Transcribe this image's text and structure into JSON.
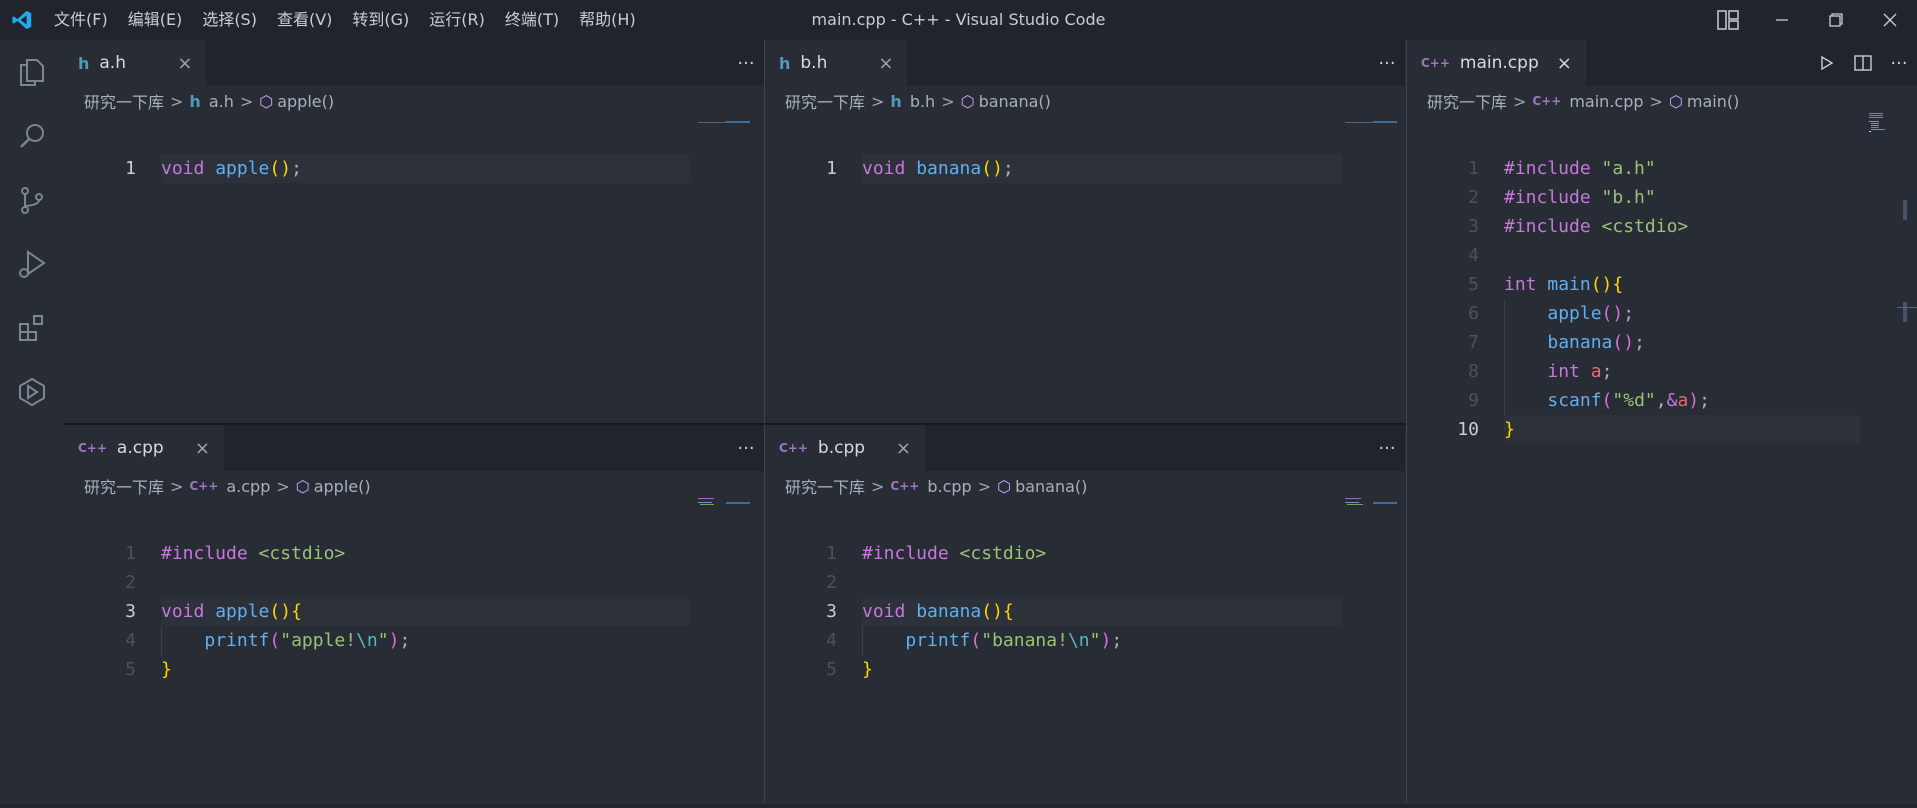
{
  "titlebar": {
    "title": "main.cpp - C++ - Visual Studio Code",
    "menu": [
      "文件(F)",
      "编辑(E)",
      "选择(S)",
      "查看(V)",
      "转到(G)",
      "运行(R)",
      "终端(T)",
      "帮助(H)"
    ]
  },
  "activitybar": {
    "items": [
      "explorer-icon",
      "search-icon",
      "source-control-icon",
      "run-debug-icon",
      "extensions-icon",
      "remote-explorer-icon"
    ]
  },
  "groups": {
    "top_left": {
      "tab": "a.h",
      "breadcrumb": {
        "folder": "研究一下库",
        "file": "a.h",
        "symbol": "apple()"
      }
    },
    "top_middle": {
      "tab": "b.h",
      "breadcrumb": {
        "folder": "研究一下库",
        "file": "b.h",
        "symbol": "banana()"
      }
    },
    "bottom_left": {
      "tab": "a.cpp",
      "breadcrumb": {
        "folder": "研究一下库",
        "file": "a.cpp",
        "symbol": "apple()"
      }
    },
    "bottom_middle": {
      "tab": "b.cpp",
      "breadcrumb": {
        "folder": "研究一下库",
        "file": "b.cpp",
        "symbol": "banana()"
      }
    },
    "right": {
      "tab": "main.cpp",
      "breadcrumb": {
        "folder": "研究一下库",
        "file": "main.cpp",
        "symbol": "main()"
      }
    }
  },
  "labels": {
    "more": "···",
    "close": "×",
    "chev": ">",
    "h_icon": "h",
    "cpp_icon": "C++",
    "sym_icon": "⬡"
  },
  "code": {
    "a_h": [
      {
        "n": "1",
        "tokens": [
          [
            "k",
            "void"
          ],
          [
            "",
            " "
          ],
          [
            "f",
            "apple"
          ],
          [
            "p1",
            "()"
          ],
          [
            "",
            ";"
          ]
        ]
      }
    ],
    "b_h": [
      {
        "n": "1",
        "tokens": [
          [
            "k",
            "void"
          ],
          [
            "",
            " "
          ],
          [
            "f",
            "banana"
          ],
          [
            "p1",
            "()"
          ],
          [
            "",
            ";"
          ]
        ]
      }
    ],
    "a_cpp": [
      {
        "n": "1",
        "tokens": [
          [
            "k",
            "#include"
          ],
          [
            "",
            " "
          ],
          [
            "s",
            "<cstdio>"
          ]
        ]
      },
      {
        "n": "2",
        "tokens": []
      },
      {
        "n": "3",
        "tokens": [
          [
            "k",
            "void"
          ],
          [
            "",
            " "
          ],
          [
            "f",
            "apple"
          ],
          [
            "p1",
            "(){"
          ]
        ]
      },
      {
        "n": "4",
        "tokens": [
          [
            "",
            "    "
          ],
          [
            "f",
            "printf"
          ],
          [
            "p2",
            "("
          ],
          [
            "s",
            "\"apple!"
          ],
          [
            "esc",
            "\\n"
          ],
          [
            "s",
            "\""
          ],
          [
            "p2",
            ")"
          ],
          [
            "",
            ";"
          ]
        ]
      },
      {
        "n": "5",
        "tokens": [
          [
            "p1",
            "}"
          ]
        ]
      }
    ],
    "b_cpp": [
      {
        "n": "1",
        "tokens": [
          [
            "k",
            "#include"
          ],
          [
            "",
            " "
          ],
          [
            "s",
            "<cstdio>"
          ]
        ]
      },
      {
        "n": "2",
        "tokens": []
      },
      {
        "n": "3",
        "tokens": [
          [
            "k",
            "void"
          ],
          [
            "",
            " "
          ],
          [
            "f",
            "banana"
          ],
          [
            "p1",
            "(){"
          ]
        ]
      },
      {
        "n": "4",
        "tokens": [
          [
            "",
            "    "
          ],
          [
            "f",
            "printf"
          ],
          [
            "p2",
            "("
          ],
          [
            "s",
            "\"banana!"
          ],
          [
            "esc",
            "\\n"
          ],
          [
            "s",
            "\""
          ],
          [
            "p2",
            ")"
          ],
          [
            "",
            ";"
          ]
        ]
      },
      {
        "n": "5",
        "tokens": [
          [
            "p1",
            "}"
          ]
        ]
      }
    ],
    "main_cpp": [
      {
        "n": "1",
        "tokens": [
          [
            "k",
            "#include"
          ],
          [
            "",
            " "
          ],
          [
            "s",
            "\"a.h\""
          ]
        ]
      },
      {
        "n": "2",
        "tokens": [
          [
            "k",
            "#include"
          ],
          [
            "",
            " "
          ],
          [
            "s",
            "\"b.h\""
          ]
        ]
      },
      {
        "n": "3",
        "tokens": [
          [
            "k",
            "#include"
          ],
          [
            "",
            " "
          ],
          [
            "s",
            "<cstdio>"
          ]
        ]
      },
      {
        "n": "4",
        "tokens": []
      },
      {
        "n": "5",
        "tokens": [
          [
            "k",
            "int"
          ],
          [
            "",
            " "
          ],
          [
            "f",
            "main"
          ],
          [
            "p1",
            "(){"
          ]
        ]
      },
      {
        "n": "6",
        "tokens": [
          [
            "",
            "    "
          ],
          [
            "f",
            "apple"
          ],
          [
            "p2",
            "()"
          ],
          [
            "",
            ";"
          ]
        ]
      },
      {
        "n": "7",
        "tokens": [
          [
            "",
            "    "
          ],
          [
            "f",
            "banana"
          ],
          [
            "p2",
            "()"
          ],
          [
            "",
            ";"
          ]
        ]
      },
      {
        "n": "8",
        "tokens": [
          [
            "",
            "    "
          ],
          [
            "k",
            "int"
          ],
          [
            "",
            " "
          ],
          [
            "v",
            "a"
          ],
          [
            "",
            ";"
          ]
        ]
      },
      {
        "n": "9",
        "tokens": [
          [
            "",
            "    "
          ],
          [
            "f",
            "scanf"
          ],
          [
            "p2",
            "("
          ],
          [
            "s",
            "\"%d\""
          ],
          [
            "",
            ","
          ],
          [
            "k",
            "&"
          ],
          [
            "v",
            "a"
          ],
          [
            "p2",
            ")"
          ],
          [
            "",
            ";"
          ]
        ]
      },
      {
        "n": "10",
        "tokens": [
          [
            "p1",
            "}"
          ]
        ]
      }
    ]
  },
  "colors": {
    "accent": "#007acc",
    "titlebar_bg": "#21252b",
    "editor_bg": "#282c34"
  }
}
